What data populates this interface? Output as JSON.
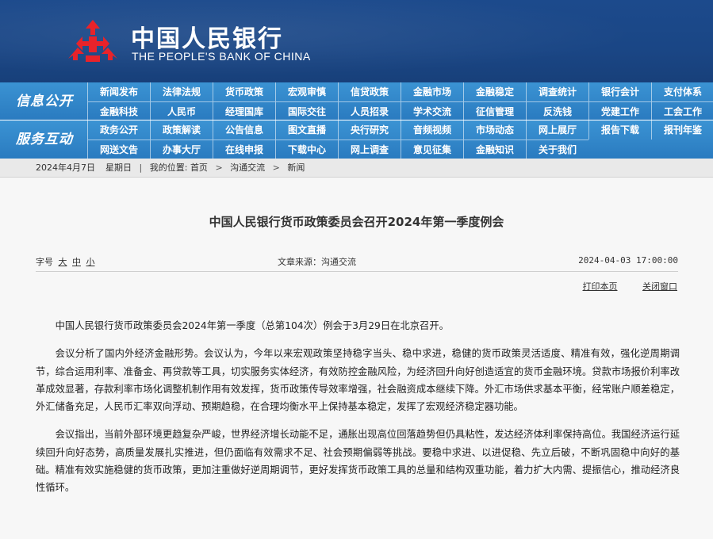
{
  "header": {
    "brand_cn": "中国人民银行",
    "brand_en": "THE PEOPLE'S BANK OF CHINA",
    "logo_color": "#e8232a",
    "bg_color": "#1c4a8c"
  },
  "nav": {
    "info_label": "信息公开",
    "service_label": "服务互动",
    "info_row1": [
      "新闻发布",
      "法律法规",
      "货币政策",
      "宏观审慎",
      "信贷政策",
      "金融市场",
      "金融稳定",
      "调查统计",
      "银行会计",
      "支付体系"
    ],
    "info_row2": [
      "金融科技",
      "人民币",
      "经理国库",
      "国际交往",
      "人员招录",
      "学术交流",
      "征信管理",
      "反洗钱",
      "党建工作",
      "工会工作"
    ],
    "service_row1": [
      "政务公开",
      "政策解读",
      "公告信息",
      "图文直播",
      "央行研究",
      "音频视频",
      "市场动态",
      "网上展厅",
      "报告下载",
      "报刊年鉴"
    ],
    "service_row2": [
      "网送文告",
      "办事大厅",
      "在线申报",
      "下载中心",
      "网上调查",
      "意见征集",
      "金融知识",
      "关于我们"
    ]
  },
  "breadcrumb": {
    "date": "2024年4月7日",
    "weekday": "星期日",
    "location_label": "我的位置:",
    "home": "首页",
    "section": "沟通交流",
    "current": "新闻",
    "separator": ">"
  },
  "article": {
    "title": "中国人民银行货币政策委员会召开2024年第一季度例会",
    "font_size_label": "字号",
    "size_large": "大",
    "size_medium": "中",
    "size_small": "小",
    "source": "文章来源：沟通交流",
    "datetime": "2024-04-03 17:00:00",
    "print_label": "打印本页",
    "close_label": "关闭窗口",
    "paragraphs": [
      "中国人民银行货币政策委员会2024年第一季度（总第104次）例会于3月29日在北京召开。",
      "会议分析了国内外经济金融形势。会议认为，今年以来宏观政策坚持稳字当头、稳中求进，稳健的货币政策灵活适度、精准有效，强化逆周期调节，综合运用利率、准备金、再贷款等工具，切实服务实体经济，有效防控金融风险，为经济回升向好创造适宜的货币金融环境。贷款市场报价利率改革成效显著，存款利率市场化调整机制作用有效发挥，货币政策传导效率增强，社会融资成本继续下降。外汇市场供求基本平衡，经常账户顺差稳定，外汇储备充足，人民币汇率双向浮动、预期趋稳，在合理均衡水平上保持基本稳定，发挥了宏观经济稳定器功能。",
      "会议指出，当前外部环境更趋复杂严峻，世界经济增长动能不足，通胀出现高位回落趋势但仍具粘性，发达经济体利率保持高位。我国经济运行延续回升向好态势，高质量发展扎实推进，但仍面临有效需求不足、社会预期偏弱等挑战。要稳中求进、以进促稳、先立后破，不断巩固稳中向好的基础。精准有效实施稳健的货币政策，更加注重做好逆周期调节，更好发挥货币政策工具的总量和结构双重功能，着力扩大内需、提振信心，推动经济良性循环。"
    ]
  }
}
